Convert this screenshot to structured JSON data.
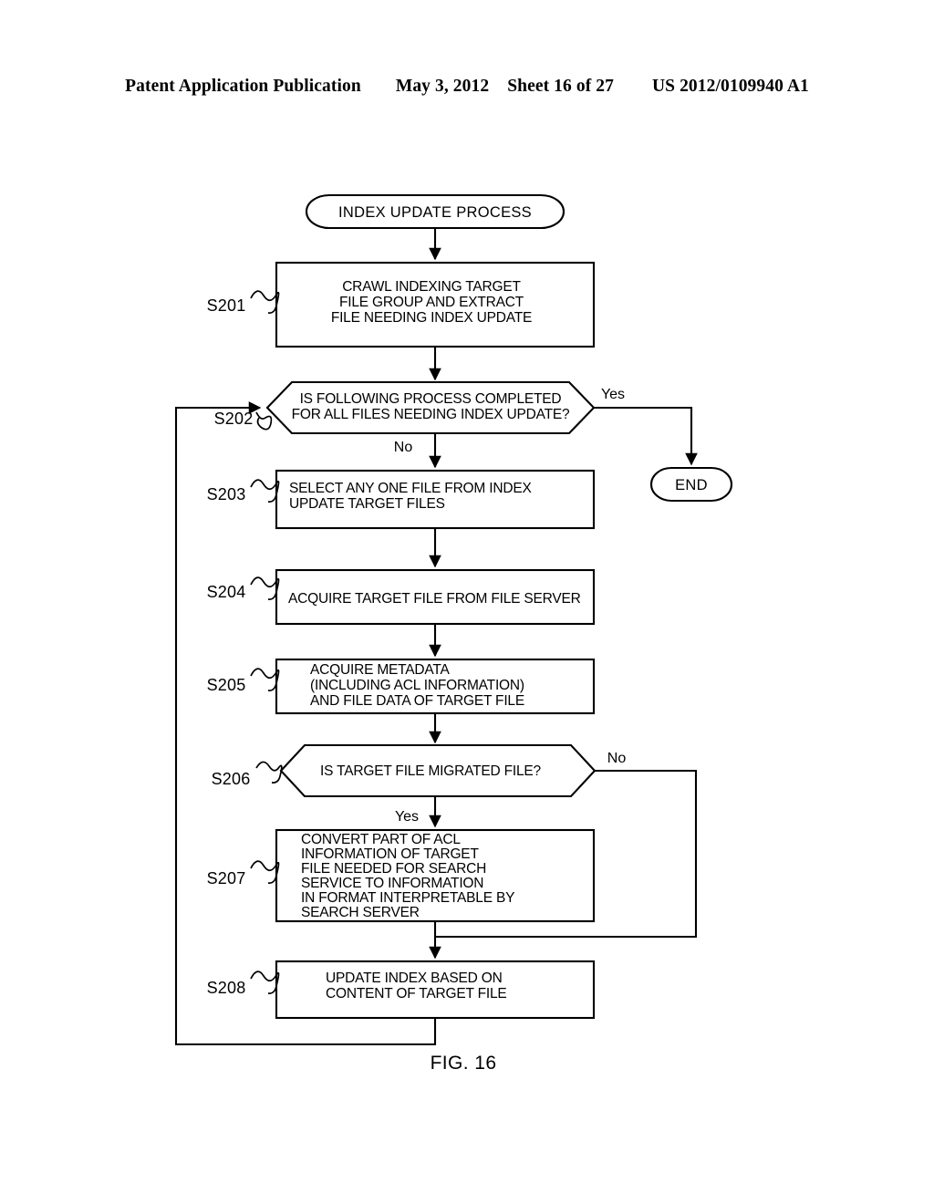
{
  "header": {
    "publication": "Patent Application Publication",
    "date": "May 3, 2012",
    "sheet": "Sheet 16 of 27",
    "patent_number": "US 2012/0109940 A1"
  },
  "figure": {
    "caption": "FIG. 16",
    "title": "INDEX UPDATE PROCESS",
    "end_label": "END",
    "colors": {
      "stroke": "#000000",
      "fill": "#ffffff",
      "text": "#000000"
    },
    "nodes": [
      {
        "id": "start",
        "type": "terminator",
        "step": "",
        "lines": [
          "INDEX UPDATE PROCESS"
        ]
      },
      {
        "id": "s201",
        "type": "process",
        "step": "S201",
        "align": "center",
        "lines": [
          "CRAWL INDEXING TARGET",
          "FILE GROUP AND EXTRACT",
          "FILE NEEDING INDEX UPDATE"
        ]
      },
      {
        "id": "s202",
        "type": "decision",
        "step": "S202",
        "align": "center",
        "lines": [
          "IS FOLLOWING PROCESS COMPLETED",
          "FOR ALL FILES NEEDING INDEX UPDATE?"
        ],
        "branch_yes": "Yes",
        "branch_no": "No"
      },
      {
        "id": "s203",
        "type": "process",
        "step": "S203",
        "align": "start",
        "lines": [
          "SELECT ANY ONE FILE FROM INDEX",
          "UPDATE TARGET FILES"
        ]
      },
      {
        "id": "s204",
        "type": "process",
        "step": "S204",
        "align": "start",
        "lines": [
          "ACQUIRE TARGET FILE FROM FILE SERVER"
        ]
      },
      {
        "id": "s205",
        "type": "process",
        "step": "S205",
        "align": "start",
        "lines": [
          "ACQUIRE METADATA",
          "(INCLUDING ACL INFORMATION)",
          "AND FILE DATA OF TARGET FILE"
        ]
      },
      {
        "id": "s206",
        "type": "decision",
        "step": "S206",
        "align": "center",
        "lines": [
          "IS TARGET FILE MIGRATED FILE?"
        ],
        "branch_yes": "Yes",
        "branch_no": "No"
      },
      {
        "id": "s207",
        "type": "process",
        "step": "S207",
        "align": "start",
        "lines": [
          "CONVERT PART OF ACL",
          "INFORMATION OF TARGET",
          "FILE NEEDED FOR SEARCH",
          "SERVICE TO INFORMATION",
          "IN FORMAT INTERPRETABLE BY",
          "SEARCH SERVER"
        ]
      },
      {
        "id": "s208",
        "type": "process",
        "step": "S208",
        "align": "start",
        "lines": [
          "UPDATE INDEX BASED ON",
          "CONTENT OF TARGET FILE"
        ]
      },
      {
        "id": "end",
        "type": "terminator",
        "step": "",
        "lines": [
          "END"
        ]
      }
    ],
    "branch_labels": {
      "s202_yes": "Yes",
      "s202_no": "No",
      "s206_yes": "Yes",
      "s206_no": "No"
    },
    "step_labels": {
      "s201": "S201",
      "s202": "S202",
      "s203": "S203",
      "s204": "S204",
      "s205": "S205",
      "s206": "S206",
      "s207": "S207",
      "s208": "S208"
    }
  }
}
